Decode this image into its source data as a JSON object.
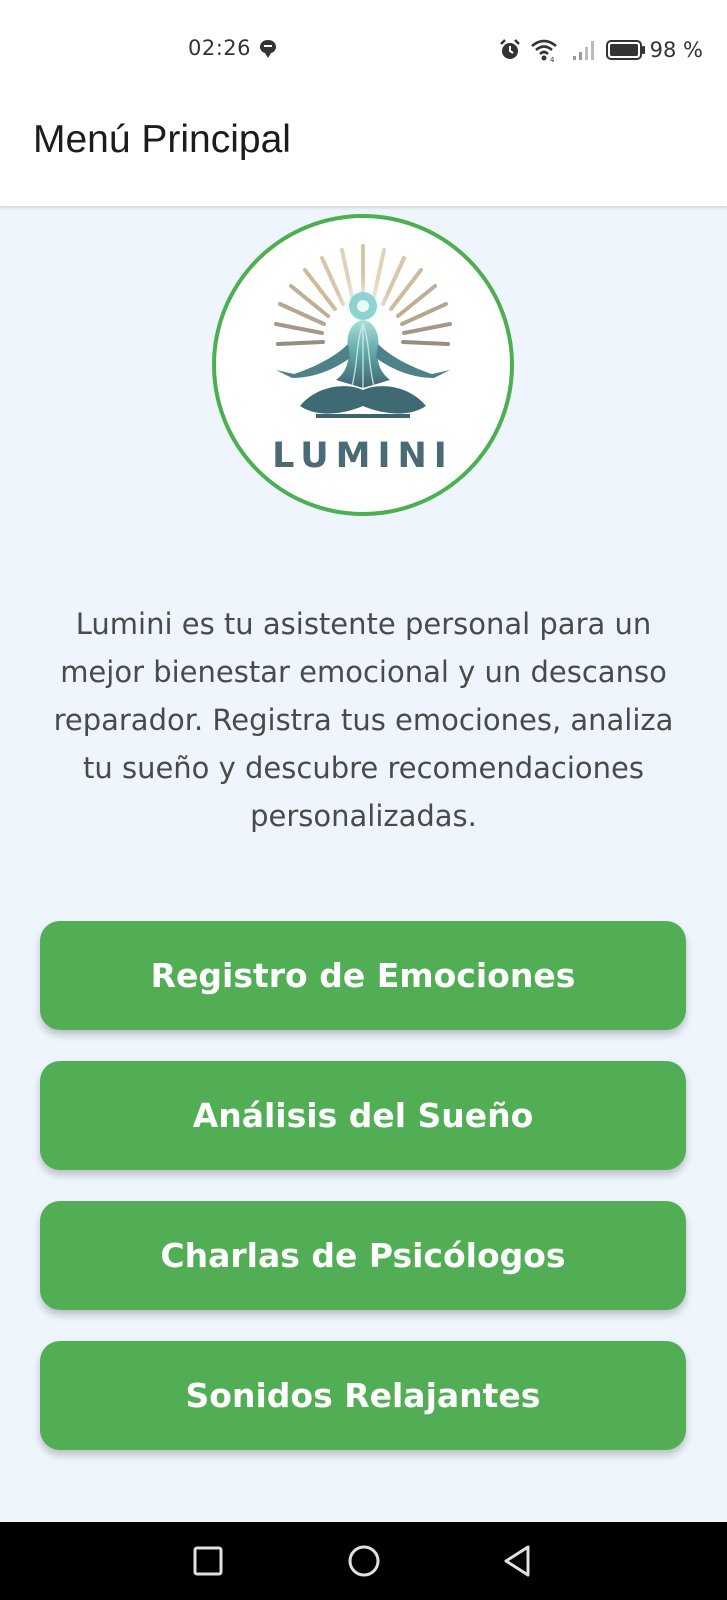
{
  "status_bar": {
    "time": "02:26",
    "battery": "98 %",
    "icons": [
      "message-icon",
      "alarm-icon",
      "wifi-icon",
      "signal-icon",
      "battery-icon"
    ]
  },
  "app_bar": {
    "title": "Menú Principal"
  },
  "logo": {
    "text": "LUMINI",
    "border_color": "#4caf50"
  },
  "description": "Lumini es tu asistente personal para un mejor bienestar emocional y un descanso reparador. Registra tus emociones, analiza tu sueño y descubre recomendaciones personalizadas.",
  "menu": {
    "buttons": [
      {
        "label": "Registro de Emociones"
      },
      {
        "label": "Análisis del Sueño"
      },
      {
        "label": "Charlas de Psicólogos"
      },
      {
        "label": "Sonidos Relajantes"
      }
    ]
  },
  "nav_bar": {
    "icons": [
      "recents-icon",
      "home-icon",
      "back-icon"
    ]
  },
  "colors": {
    "accent": "#52ae54",
    "background": "#eef5fd",
    "app_bar": "#ffffff"
  }
}
